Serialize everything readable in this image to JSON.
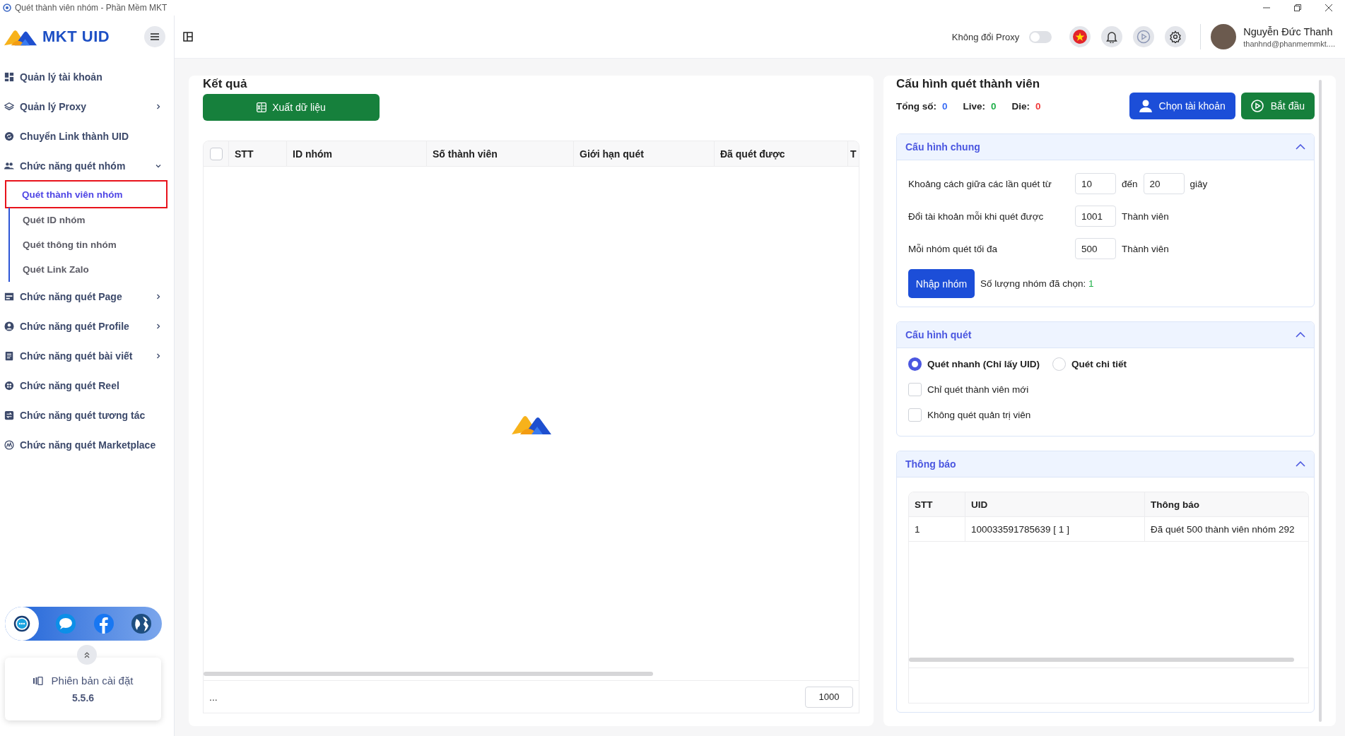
{
  "window": {
    "title": "Quét thành viên nhóm - Phần Mềm MKT"
  },
  "brand": {
    "name": "MKT UID"
  },
  "topbar": {
    "proxy_toggle": {
      "label": "Không đổi Proxy",
      "on": false
    },
    "user": {
      "name": "Nguyễn Đức Thanh",
      "email": "thanhnd@phanmemmkt...."
    }
  },
  "sidebar": {
    "items": [
      {
        "label": "Quản lý tài khoản",
        "kind": "link"
      },
      {
        "label": "Quản lý Proxy",
        "kind": "group",
        "expanded": false
      },
      {
        "label": "Chuyển Link thành UID",
        "kind": "link"
      },
      {
        "label": "Chức năng quét nhóm",
        "kind": "group",
        "expanded": true,
        "children": [
          {
            "label": "Quét thành viên nhóm",
            "selected": true
          },
          {
            "label": "Quét ID nhóm",
            "selected": false
          },
          {
            "label": "Quét thông tin nhóm",
            "selected": false
          },
          {
            "label": "Quét Link Zalo",
            "selected": false
          }
        ]
      },
      {
        "label": "Chức năng quét Page",
        "kind": "group",
        "expanded": false
      },
      {
        "label": "Chức năng quét Profile",
        "kind": "group",
        "expanded": false
      },
      {
        "label": "Chức năng quét bài viết",
        "kind": "group",
        "expanded": false
      },
      {
        "label": "Chức năng quét Reel",
        "kind": "link"
      },
      {
        "label": "Chức năng quét tương tác",
        "kind": "link"
      },
      {
        "label": "Chức năng quét Marketplace",
        "kind": "link"
      }
    ],
    "version": {
      "label": "Phiên bản cài đặt",
      "value": "5.5.6"
    }
  },
  "results": {
    "title": "Kết quả",
    "export_button": "Xuất dữ liệu",
    "table": {
      "all_checked": false,
      "columns": [
        "STT",
        "ID nhóm",
        "Số thành viên",
        "Giới hạn quét",
        "Đã quét được",
        "T"
      ]
    },
    "footer_text": "...",
    "page_size": "1000"
  },
  "config": {
    "title": "Cấu hình quét thành viên",
    "stats": [
      {
        "label": "Tổng số:",
        "value": "0",
        "color": "#3b6ef5"
      },
      {
        "label": "Live:",
        "value": "0",
        "color": "#22b04b"
      },
      {
        "label": "Die:",
        "value": "0",
        "color": "#f03a3a"
      }
    ],
    "buttons": [
      {
        "label": "Chọn tài khoản",
        "kind": "account"
      },
      {
        "label": "Bắt đầu",
        "kind": "start"
      }
    ],
    "general": {
      "title": "Cấu hình chung",
      "expanded": true,
      "rows": [
        {
          "label": "Khoảng cách giữa các lần quét từ",
          "fields": [
            "10",
            "20"
          ],
          "between": "đến",
          "unit": "giây"
        },
        {
          "label": "Đổi tài khoản mỗi khi quét được",
          "fields": [
            "1001"
          ],
          "unit": "Thành viên"
        },
        {
          "label": "Mỗi nhóm quét tối đa",
          "fields": [
            "500"
          ],
          "unit": "Thành viên"
        }
      ],
      "import_button": "Nhập nhóm",
      "selected_count": {
        "label": "Số lượng nhóm đã chọn:",
        "value": "1"
      }
    },
    "scan": {
      "title": "Cấu hình quét",
      "expanded": true,
      "modes": [
        {
          "label": "Quét nhanh (Chỉ lấy UID)",
          "selected": true
        },
        {
          "label": "Quét chi tiết",
          "selected": false
        }
      ],
      "options": [
        {
          "label": "Chỉ quét thành viên mới",
          "checked": false
        },
        {
          "label": "Không quét quản trị viên",
          "checked": false
        }
      ]
    },
    "notifications": {
      "title": "Thông báo",
      "expanded": true,
      "table": {
        "columns": [
          "STT",
          "UID",
          "Thông báo"
        ],
        "rows": [
          [
            "1",
            "100033591785639 [ 1 ]",
            "Đã quét 500 thành viên nhóm 292"
          ]
        ]
      }
    }
  }
}
